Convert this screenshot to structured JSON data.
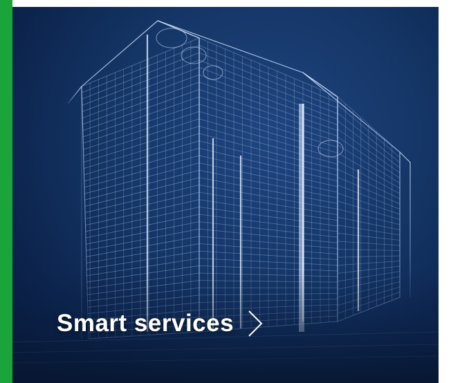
{
  "card": {
    "label": "Smart services",
    "accent_color": "#1aa53a",
    "background_color": "#143565",
    "image_subject": "wireframe-skyscraper-blueprint",
    "link_icon": "chevron-right-icon"
  }
}
